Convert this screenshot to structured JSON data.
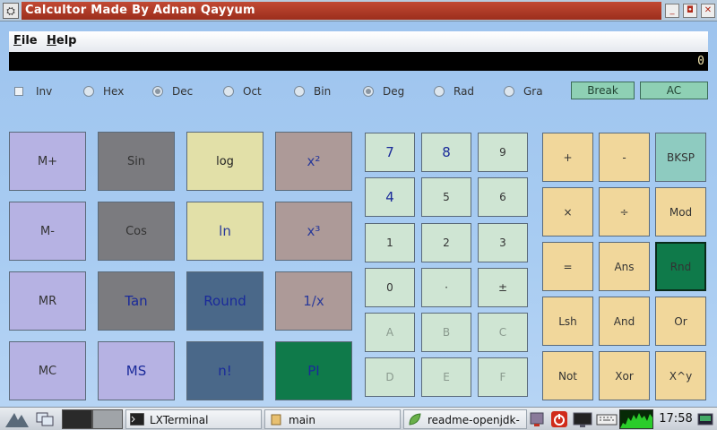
{
  "window": {
    "title": "Calcultor Made By Adnan Qayyum"
  },
  "menu": [
    "File",
    "Help"
  ],
  "display": {
    "value": "0"
  },
  "options": {
    "inv": "Inv",
    "bases": [
      "Hex",
      "Dec",
      "Oct",
      "Bin"
    ],
    "angles": [
      "Deg",
      "Rad",
      "Gra"
    ],
    "selected_base": "Dec",
    "selected_angle": "Deg",
    "break_label": "Break",
    "ac_label": "AC"
  },
  "function_buttons": [
    [
      "M+",
      "Sin",
      "log",
      "x²"
    ],
    [
      "M-",
      "Cos",
      "ln",
      "x³"
    ],
    [
      "MR",
      "Tan",
      "Round",
      "1/x"
    ],
    [
      "MC",
      "MS",
      "n!",
      "PI"
    ]
  ],
  "number_pad": [
    [
      "7",
      "8",
      "9"
    ],
    [
      "4",
      "5",
      "6"
    ],
    [
      "1",
      "2",
      "3"
    ],
    [
      "0",
      "·",
      "±"
    ],
    [
      "A",
      "B",
      "C"
    ],
    [
      "D",
      "E",
      "F"
    ]
  ],
  "operator_pad": [
    [
      "+",
      "-",
      "BKSP"
    ],
    [
      "×",
      "÷",
      "Mod"
    ],
    [
      "=",
      "Ans",
      "Rnd"
    ],
    [
      "Lsh",
      "And",
      "Or"
    ],
    [
      "Not",
      "Xor",
      "X^y"
    ]
  ],
  "taskbar": {
    "items": [
      "LXTerminal",
      "main",
      "readme-openjdk-"
    ],
    "clock": "17:58"
  },
  "colors": {
    "title": "#a8382a",
    "mem": "#b6b2e3",
    "trig": "#7b7b7f",
    "log": "#e2e0a8",
    "pow": "#ad9a98",
    "round": "#4a6889",
    "pi": "#0f7a4a",
    "num": "#cfe5d3",
    "op": "#f1d79b",
    "bksp": "#8ecbc0",
    "rnd": "#0f7a4a"
  }
}
